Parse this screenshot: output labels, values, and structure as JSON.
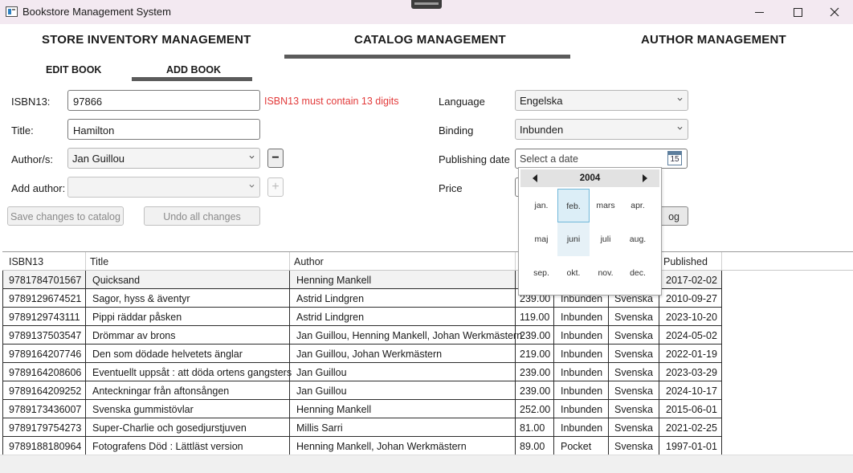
{
  "window": {
    "title": "Bookstore Management System"
  },
  "main_tabs": [
    {
      "label": "STORE INVENTORY MANAGEMENT"
    },
    {
      "label": "CATALOG MANAGEMENT"
    },
    {
      "label": "AUTHOR MANAGEMENT"
    }
  ],
  "active_main_tab": "CATALOG MANAGEMENT",
  "sub_tabs": [
    {
      "label": "EDIT BOOK"
    },
    {
      "label": "ADD BOOK"
    }
  ],
  "active_sub_tab": "ADD BOOK",
  "form": {
    "isbn_label": "ISBN13:",
    "isbn_value": "97866",
    "isbn_error": "ISBN13 must contain 13 digits",
    "title_label": "Title:",
    "title_value": "Hamilton",
    "authors_label": "Author/s:",
    "authors_value": "Jan Guillou",
    "remove_author_glyph": "−",
    "add_author_label": "Add author:",
    "add_author_value": "",
    "add_author_glyph": "+",
    "language_label": "Language",
    "language_value": "Engelska",
    "binding_label": "Binding",
    "binding_value": "Inbunden",
    "publishing_date_label": "Publishing date",
    "publishing_date_placeholder": "Select a date",
    "calendar_icon_day": "15",
    "price_label": "Price",
    "add_to_catalog_partial": "og",
    "save_button": "Save changes to catalog",
    "undo_button": "Undo all changes"
  },
  "calendar": {
    "year": "2004",
    "selected_month": "feb.",
    "months": [
      "jan.",
      "feb.",
      "mars",
      "apr.",
      "maj",
      "juni",
      "juli",
      "aug.",
      "sep.",
      "okt.",
      "nov.",
      "dec."
    ]
  },
  "table": {
    "columns": [
      "ISBN13",
      "Title",
      "Author",
      "",
      "",
      "",
      "Published"
    ],
    "rows": [
      {
        "isbn": "9781784701567",
        "title": "Quicksand",
        "author": "Henning Mankell",
        "price": "",
        "binding": "",
        "language": "",
        "published": "2017-02-02"
      },
      {
        "isbn": "9789129674521",
        "title": "Sagor, hyss & äventyr",
        "author": "Astrid Lindgren",
        "price": "239.00",
        "binding": "Inbunden",
        "language": "Svenska",
        "published": "2010-09-27"
      },
      {
        "isbn": "9789129743111",
        "title": "Pippi räddar påsken",
        "author": "Astrid Lindgren",
        "price": "119.00",
        "binding": "Inbunden",
        "language": "Svenska",
        "published": "2023-10-20"
      },
      {
        "isbn": "9789137503547",
        "title": "Drömmar av brons",
        "author": "Jan Guillou, Henning Mankell, Johan Werkmästern",
        "price": "239.00",
        "binding": "Inbunden",
        "language": "Svenska",
        "published": "2024-05-02"
      },
      {
        "isbn": "9789164207746",
        "title": "Den som dödade helvetets änglar",
        "author": "Jan Guillou, Johan Werkmästern",
        "price": "219.00",
        "binding": "Inbunden",
        "language": "Svenska",
        "published": "2022-01-19"
      },
      {
        "isbn": "9789164208606",
        "title": "Eventuellt uppsåt : att döda ortens gangsters",
        "author": "Jan Guillou",
        "price": "239.00",
        "binding": "Inbunden",
        "language": "Svenska",
        "published": "2023-03-29"
      },
      {
        "isbn": "9789164209252",
        "title": "Anteckningar från aftonsången",
        "author": "Jan Guillou",
        "price": "239.00",
        "binding": "Inbunden",
        "language": "Svenska",
        "published": "2024-10-17"
      },
      {
        "isbn": "9789173436007",
        "title": "Svenska gummistövlar",
        "author": "Henning Mankell",
        "price": "252.00",
        "binding": "Inbunden",
        "language": "Svenska",
        "published": "2015-06-01"
      },
      {
        "isbn": "9789179754273",
        "title": "Super-Charlie och gosedjurstjuven",
        "author": "Millis Sarri",
        "price": "81.00",
        "binding": "Inbunden",
        "language": "Svenska",
        "published": "2021-02-25"
      },
      {
        "isbn": "9789188180964",
        "title": "Fotografens Död : Lättläst version",
        "author": "Henning Mankell, Johan Werkmästern",
        "price": "89.00",
        "binding": "Pocket",
        "language": "Svenska",
        "published": "1997-01-01"
      }
    ]
  }
}
